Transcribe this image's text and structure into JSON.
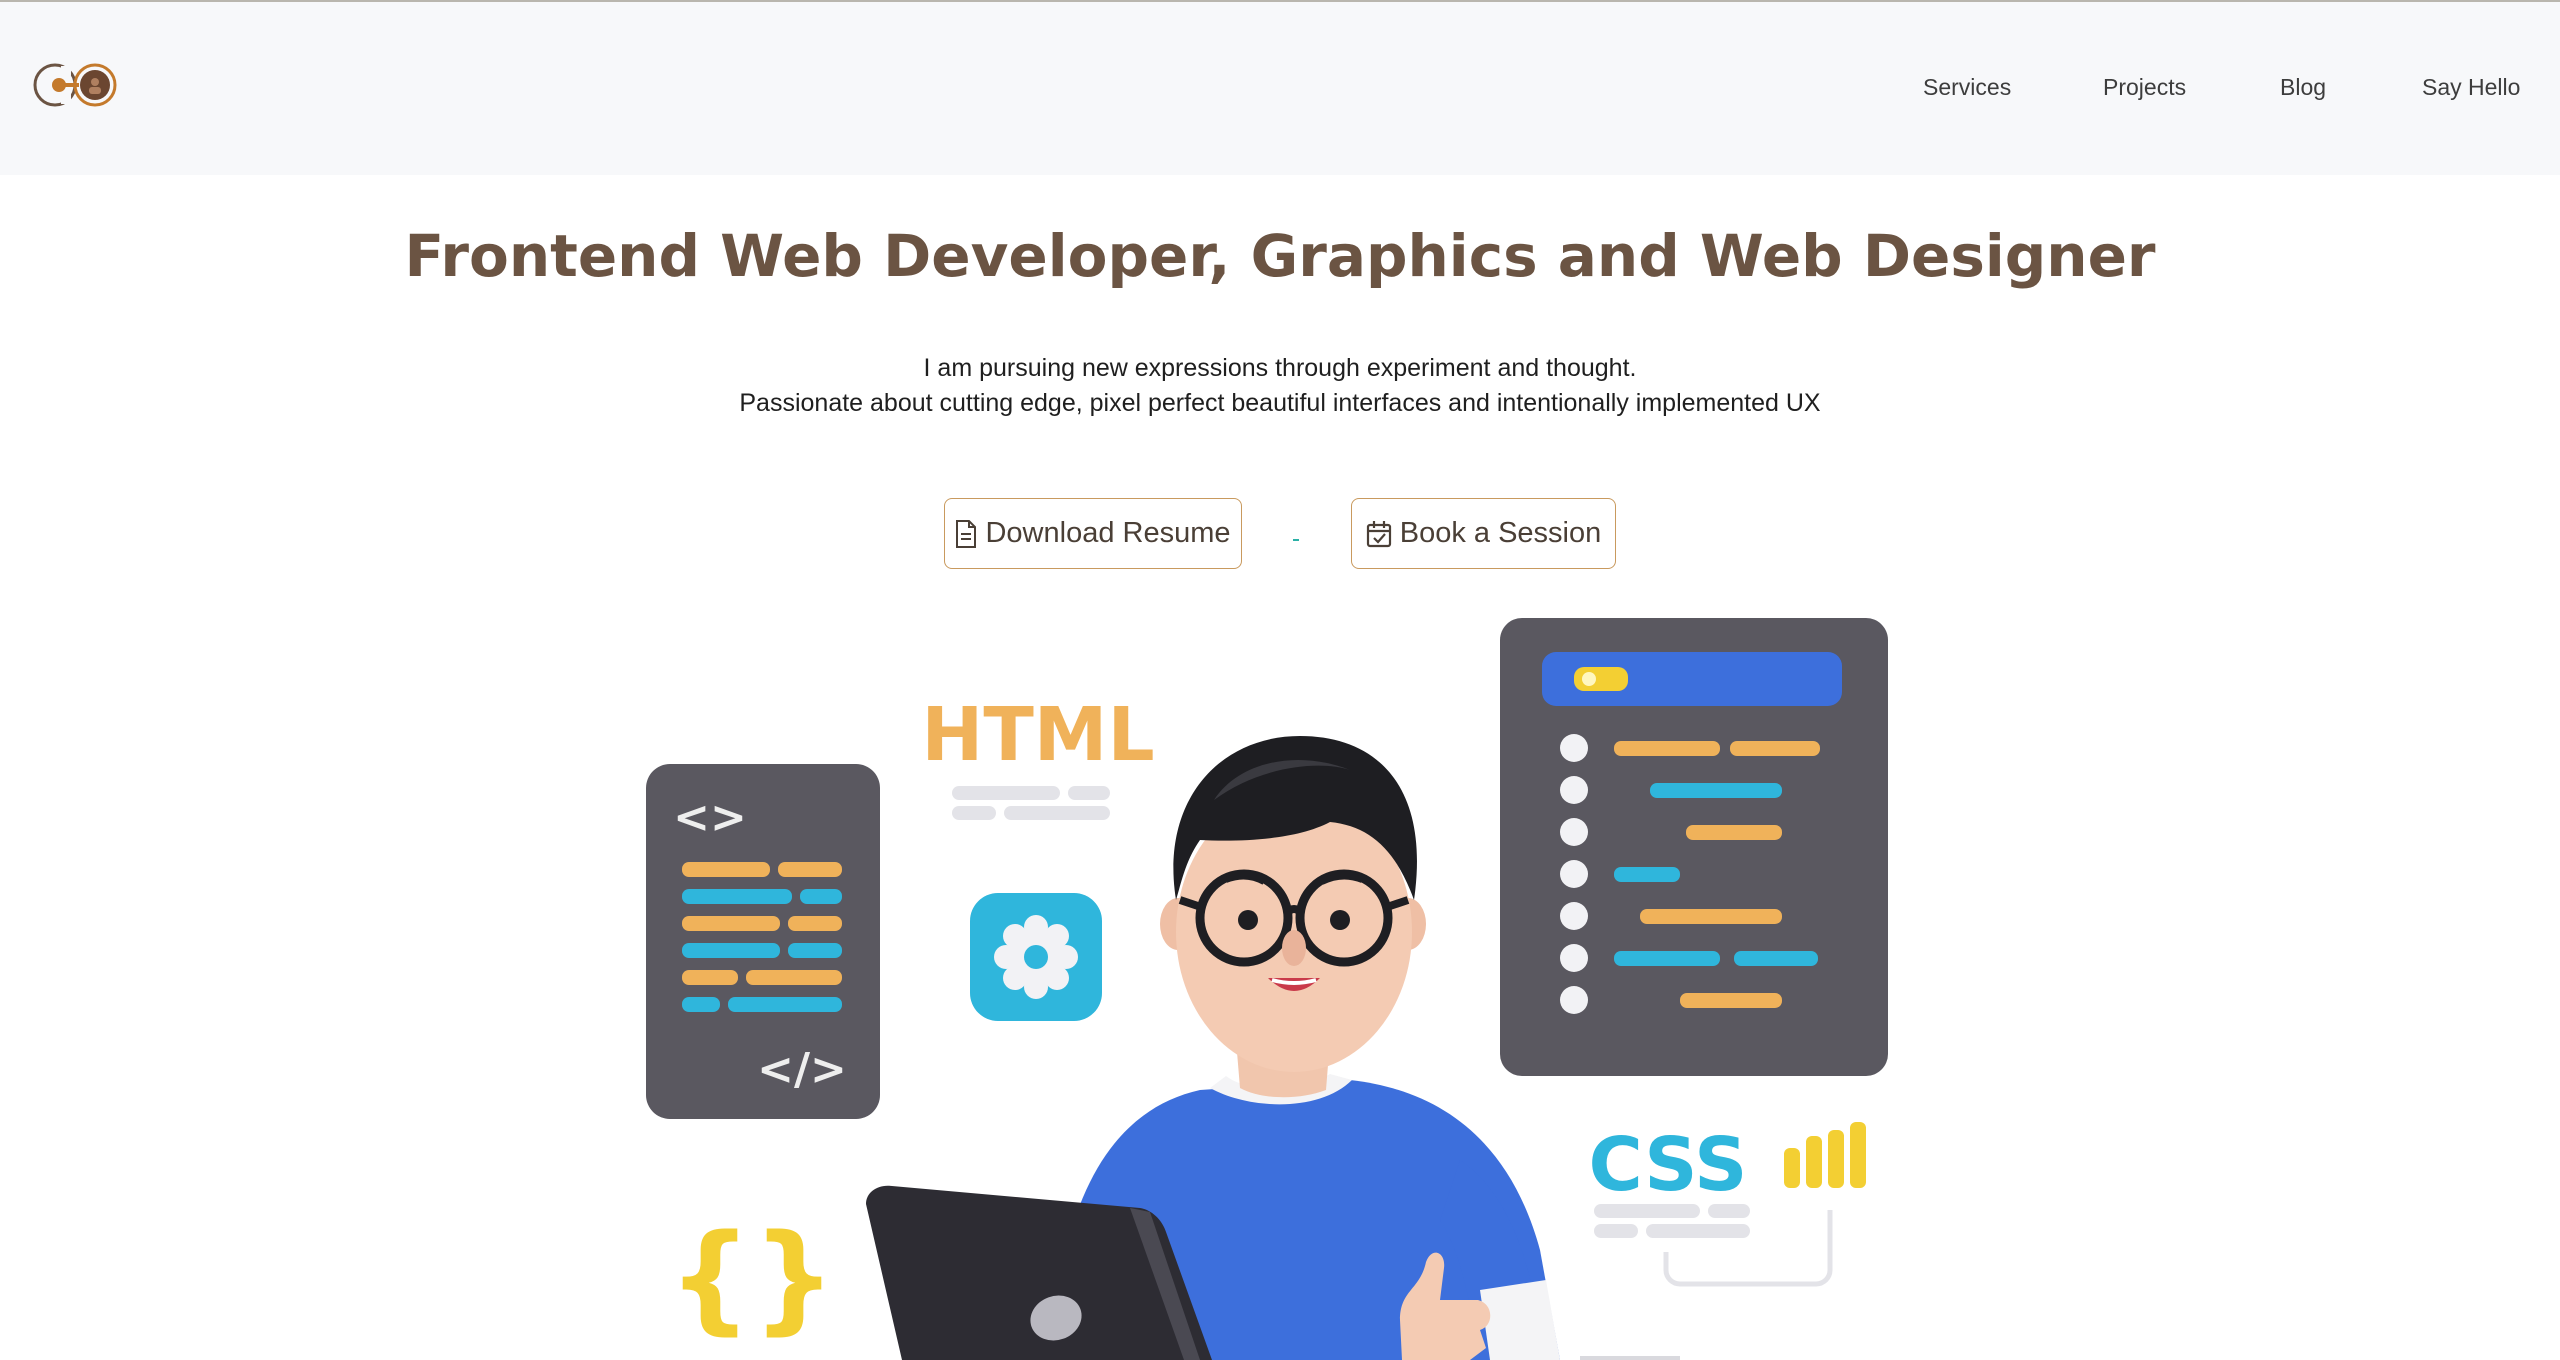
{
  "header": {
    "logo_alt": "CO",
    "nav": [
      {
        "label": "Services"
      },
      {
        "label": "Projects"
      },
      {
        "label": "Blog"
      },
      {
        "label": "Say Hello"
      }
    ]
  },
  "hero": {
    "title": "Frontend Web Developer, Graphics and Web Designer",
    "line1": "I am pursuing new expressions through experiment and thought.",
    "line2": "Passionate about cutting edge, pixel perfect beautiful interfaces and intentionally implemented UX",
    "buttons": {
      "resume": "Download Resume",
      "session": "Book a Session"
    }
  },
  "illustration": {
    "html_label": "HTML",
    "css_label": "CSS",
    "code_symbol_top": "<>",
    "code_symbol_bottom": "</>",
    "braces": "{}"
  },
  "colors": {
    "brand_brown": "#6b5443",
    "button_border": "#c99a5e",
    "header_bg": "#f7f8fa",
    "accent_orange": "#f0b25a",
    "accent_cyan": "#2fb6dc",
    "accent_yellow": "#f3cf33",
    "shirt_blue": "#3d6fdc"
  }
}
